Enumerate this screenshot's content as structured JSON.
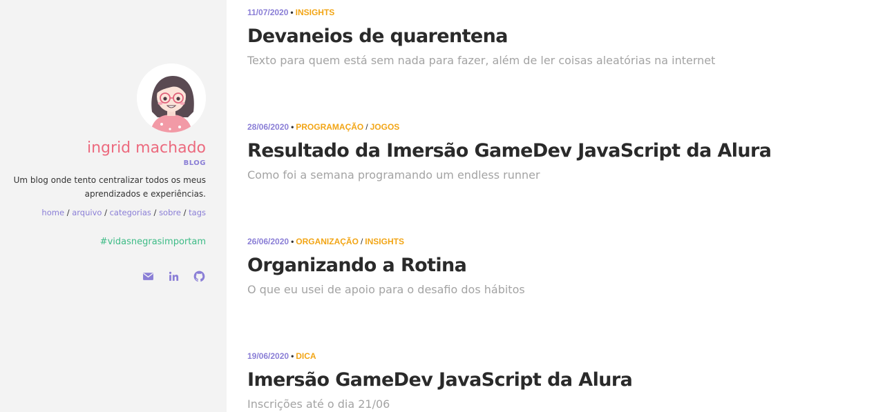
{
  "sidebar": {
    "author_name": "ingrid machado",
    "blog_label": "BLOG",
    "description": "Um blog onde tento centralizar todos os meus aprendizados e experiências.",
    "nav": [
      {
        "label": "home"
      },
      {
        "label": "arquivo"
      },
      {
        "label": "categorias"
      },
      {
        "label": "sobre"
      },
      {
        "label": "tags"
      }
    ],
    "hashtag": "#vidasnegrasimportam",
    "social_icons": [
      "email-icon",
      "linkedin-icon",
      "github-icon"
    ],
    "colors": {
      "name": "#ec6a7e",
      "accent": "#8a7ed6",
      "hashtag": "#3dbb86",
      "background": "#f3f3f3"
    }
  },
  "posts": [
    {
      "date": "11/07/2020",
      "categories": [
        "INSIGHTS"
      ],
      "title": "Devaneios de quarentena",
      "subtitle": "Texto para quem está sem nada para fazer, além de ler coisas aleatórias na internet"
    },
    {
      "date": "28/06/2020",
      "categories": [
        "PROGRAMAÇÃO",
        "JOGOS"
      ],
      "title": "Resultado da Imersão GameDev JavaScript da Alura",
      "subtitle": "Como foi a semana programando um endless runner"
    },
    {
      "date": "26/06/2020",
      "categories": [
        "ORGANIZAÇÃO",
        "INSIGHTS"
      ],
      "title": "Organizando a Rotina",
      "subtitle": "O que eu usei de apoio para o desafio dos hábitos"
    },
    {
      "date": "19/06/2020",
      "categories": [
        "DICA"
      ],
      "title": "Imersão GameDev JavaScript da Alura",
      "subtitle": "Inscrições até o dia 21/06"
    }
  ],
  "colors": {
    "date": "#8a7ed6",
    "category": "#f2a515",
    "title": "#2a2a2a",
    "subtitle": "#a3a3a3"
  }
}
